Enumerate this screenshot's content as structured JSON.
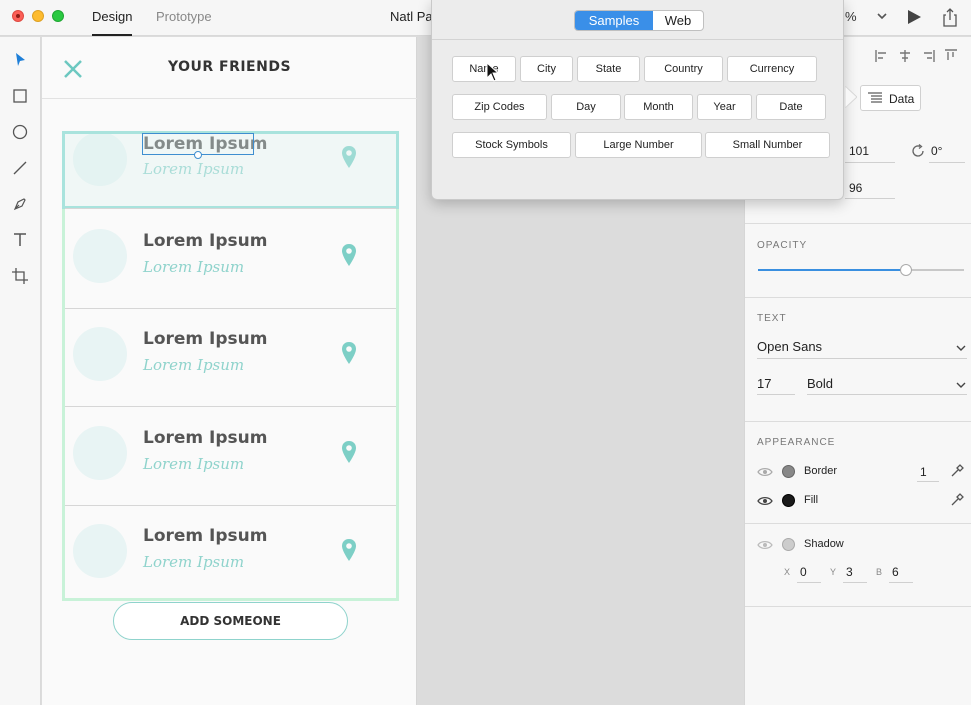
{
  "titlebar": {
    "tabs": [
      "Design",
      "Prototype"
    ],
    "doc_title": "Natl Par",
    "zoom": "%"
  },
  "artboard": {
    "title": "YOUR FRIENDS",
    "rows": [
      {
        "name": "Lorem Ipsum",
        "subtitle": "Lorem Ipsum"
      },
      {
        "name": "Lorem Ipsum",
        "subtitle": "Lorem Ipsum"
      },
      {
        "name": "Lorem Ipsum",
        "subtitle": "Lorem Ipsum"
      },
      {
        "name": "Lorem Ipsum",
        "subtitle": "Lorem Ipsum"
      },
      {
        "name": "Lorem Ipsum",
        "subtitle": "Lorem Ipsum"
      }
    ],
    "add_button": "ADD SOMEONE"
  },
  "popover": {
    "segments": [
      "Samples",
      "Web"
    ],
    "selected_segment": "Samples",
    "buttons_row1": [
      "Name",
      "City",
      "State",
      "Country",
      "Currency"
    ],
    "buttons_row2": [
      "Zip Codes",
      "Day",
      "Month",
      "Year",
      "Date"
    ],
    "buttons_row3": [
      "Stock Symbols",
      "Large Number",
      "Small Number"
    ]
  },
  "props": {
    "data_button": "Data",
    "x_value": "101",
    "rotation": "0°",
    "y_value": "96",
    "opacity_title": "OPACITY",
    "opacity_level": 0.72,
    "text_title": "TEXT",
    "font_family": "Open Sans",
    "font_size": "17",
    "font_weight": "Bold",
    "appearance_title": "APPEARANCE",
    "border_label": "Border",
    "border_value": "1",
    "fill_label": "Fill",
    "shadow_label": "Shadow",
    "shadow_x_label": "X",
    "shadow_x": "0",
    "shadow_y_label": "Y",
    "shadow_y": "3",
    "shadow_b_label": "B",
    "shadow_b": "6"
  },
  "colors": {
    "accent_blue": "#3a8fe8",
    "teal": "#8fd3cc",
    "grid_green": "#c8f2d8",
    "border_swatch": "#888888",
    "fill_swatch": "#1a1a1a",
    "shadow_swatch": "#cccccc"
  }
}
